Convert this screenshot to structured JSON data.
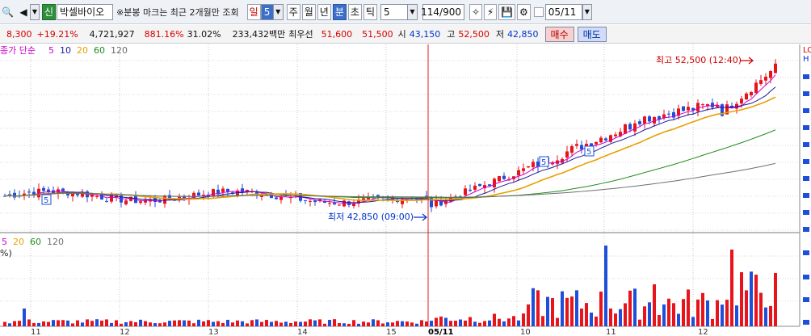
{
  "toolbar": {
    "stock_badge": "신",
    "stock_name": "박셀바이오",
    "note": "※분봉 마크는 최근 2개월만 조회",
    "period_buttons": [
      "일",
      "주",
      "월",
      "년",
      "분",
      "초",
      "틱"
    ],
    "selected_period": "분",
    "day_count": "5",
    "minute_interval": "5",
    "page_count": "114/900",
    "date": "05/11"
  },
  "quote": {
    "price": "8,300",
    "change_pct": "+19.21%",
    "volume": "4,721,927",
    "volume_ratio": "881.16%",
    "turnover": "31.02%",
    "amount": "233,432백만",
    "best_label": "최우선",
    "best_ask": "51,600",
    "best_bid": "51,500",
    "open_label": "시",
    "open": "43,150",
    "high_label": "고",
    "high": "52,500",
    "low_label": "저",
    "low": "42,850",
    "buy_label": "매수",
    "sell_label": "매도"
  },
  "colors": {
    "up": "#e8141b",
    "down": "#1e4fd8",
    "ma5": "#cc00cc",
    "ma10": "#1a1aa0",
    "ma20": "#e8a000",
    "ma60": "#1e8c1e",
    "ma120": "#6e6e6e"
  },
  "chart_data": {
    "type": "candlestick",
    "price_legend": [
      "종가 단순",
      "5",
      "10",
      "20",
      "60",
      "120"
    ],
    "volume_legend": [
      "5",
      "20",
      "60",
      "120"
    ],
    "volume_unit": "%)",
    "high_annotation": "최고 52,500 (12:40)",
    "low_annotation": "최저 42,850 (09:00)",
    "cursor_date": "05/11",
    "x_ticks": [
      "11",
      "12",
      "13",
      "14",
      "15",
      "05/11",
      "10",
      "11",
      "12"
    ],
    "right_axis_labels": [
      "LO",
      "H"
    ],
    "marker_labels": [
      "5",
      "5",
      "5"
    ],
    "session_start_price": 43150,
    "high_price": 52500,
    "low_price": 42850
  }
}
